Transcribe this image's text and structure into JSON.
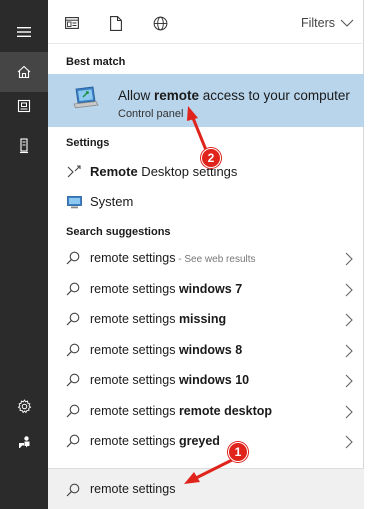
{
  "rail": {
    "items": [
      {
        "icon": "hamburger-menu-icon"
      },
      {
        "icon": "home-icon"
      },
      {
        "icon": "documents-icon"
      },
      {
        "icon": "device-icon"
      },
      {
        "icon": "settings-gear-icon"
      },
      {
        "icon": "feedback-icon"
      }
    ]
  },
  "topbar": {
    "filters_label": "Filters"
  },
  "best_match": {
    "heading": "Best match",
    "title_prefix": "Allow ",
    "title_bold": "remote",
    "title_suffix": " access to your computer",
    "subtitle": "Control panel",
    "icon": "remote-access-laptop-icon"
  },
  "settings": {
    "heading": "Settings",
    "items": [
      {
        "bold": "Remote",
        "rest": " Desktop settings",
        "icon": "remote-desktop-icon"
      },
      {
        "bold": "",
        "rest": "System",
        "icon": "monitor-icon"
      }
    ]
  },
  "suggestions": {
    "heading": "Search suggestions",
    "items": [
      {
        "base": "remote settings",
        "bold": "",
        "hint": " - See web results"
      },
      {
        "base": "remote settings ",
        "bold": "windows 7",
        "hint": ""
      },
      {
        "base": "remote settings ",
        "bold": "missing",
        "hint": ""
      },
      {
        "base": "remote settings ",
        "bold": "windows 8",
        "hint": ""
      },
      {
        "base": "remote settings ",
        "bold": "windows 10",
        "hint": ""
      },
      {
        "base": "remote settings ",
        "bold": "remote desktop",
        "hint": ""
      },
      {
        "base": "remote settings ",
        "bold": "greyed",
        "hint": ""
      }
    ]
  },
  "search": {
    "value": "remote settings"
  },
  "annotations": {
    "badge1": "1",
    "badge2": "2",
    "color": "#e0231b"
  },
  "colors": {
    "rail": "#2b2b2b",
    "highlight": "#b9d5ec"
  }
}
